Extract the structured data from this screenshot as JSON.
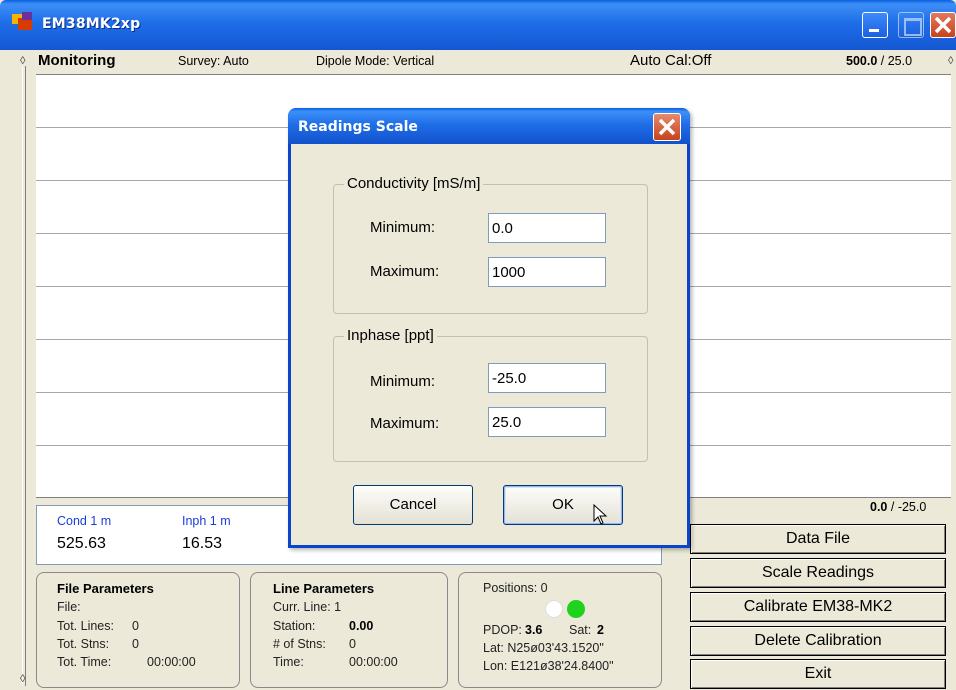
{
  "window": {
    "title": "EM38MK2xp"
  },
  "header": {
    "mode": "Monitoring",
    "survey": "Survey: Auto",
    "dipole": "Dipole Mode: Vertical",
    "autocal": "Auto Cal:Off",
    "scale_top_max": "500.0",
    "scale_top_sep": " / ",
    "scale_top_min": "25.0",
    "scale_bottom_max": "0.0",
    "scale_bottom_sep": " / ",
    "scale_bottom_min": "-25.0"
  },
  "readings": {
    "cond_label": "Cond 1 m",
    "cond_value": "525.63",
    "inph_label": "Inph 1 m",
    "inph_value": "16.53"
  },
  "buttons": {
    "data_file": "Data File",
    "scale_readings": "Scale Readings",
    "calibrate": "Calibrate EM38-MK2",
    "delete_calibration": "Delete Calibration",
    "exit": "Exit"
  },
  "file_params": {
    "title": "File Parameters",
    "file_label": "File:",
    "tot_lines_label": "Tot. Lines:",
    "tot_lines": "0",
    "tot_stns_label": "Tot. Stns:",
    "tot_stns": "0",
    "tot_time_label": "Tot. Time:",
    "tot_time": "00:00:00"
  },
  "line_params": {
    "title": "Line Parameters",
    "curr_line": "Curr. Line: 1",
    "station_label": "Station:",
    "station": "0.00",
    "num_stns_label": "# of Stns:",
    "num_stns": "0",
    "time_label": "Time:",
    "time": "00:00:00"
  },
  "gps": {
    "positions": "Positions: 0",
    "pdop_label": "PDOP:",
    "pdop": "3.6",
    "sat_label": "Sat:",
    "sat": "2",
    "lat": "Lat:  N25ø03'43.1520\"",
    "lon": "Lon: E121ø38'24.8400\"",
    "dot_colors": [
      "#ffffff",
      "#1ed21e"
    ]
  },
  "dialog": {
    "title": "Readings Scale",
    "conductivity": {
      "title": "Conductivity [mS/m]",
      "min_label": "Minimum:",
      "min_value": "0.0",
      "max_label": "Maximum:",
      "max_value": "1000"
    },
    "inphase": {
      "title": "Inphase [ppt]",
      "min_label": "Minimum:",
      "min_value": "-25.0",
      "max_label": "Maximum:",
      "max_value": "25.0"
    },
    "cancel": "Cancel",
    "ok": "OK"
  },
  "colors": {
    "titlebar": "#1f6ee8",
    "readings_label": "#1a3cde",
    "close": "#c5421f"
  }
}
